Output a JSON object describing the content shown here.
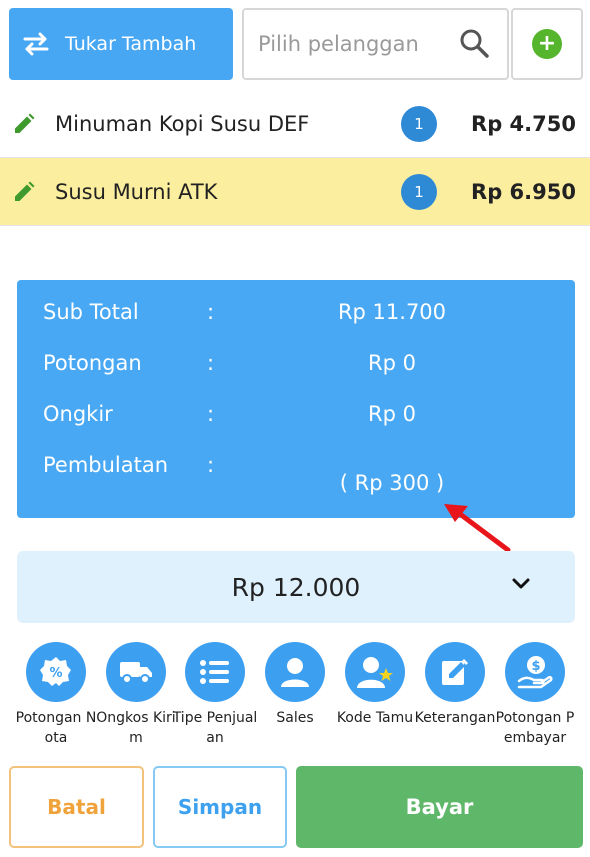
{
  "topbar": {
    "swap_label": "Tukar Tambah",
    "search_placeholder": "Pilih pelanggan"
  },
  "items": [
    {
      "name": "Minuman Kopi Susu DEF",
      "qty": "1",
      "price": "Rp 4.750",
      "highlighted": false
    },
    {
      "name": "Susu Murni ATK",
      "qty": "1",
      "price": "Rp 6.950",
      "highlighted": true
    }
  ],
  "summary": {
    "rows": [
      {
        "label": "Sub Total",
        "sep": ":",
        "value": "Rp 11.700"
      },
      {
        "label": "Potongan",
        "sep": ":",
        "value": "Rp 0"
      },
      {
        "label": "Ongkir",
        "sep": ":",
        "value": "Rp 0"
      },
      {
        "label": "Pembulatan",
        "sep": ":",
        "value": "( Rp 300 )"
      }
    ]
  },
  "total": {
    "amount": "Rp 12.000"
  },
  "options": [
    {
      "label": "Potongan Nota",
      "icon": "discount-badge-icon"
    },
    {
      "label": "Ongkos Kirim",
      "icon": "truck-icon"
    },
    {
      "label": "Tipe Penjualan",
      "icon": "list-icon"
    },
    {
      "label": "Sales",
      "icon": "person-icon"
    },
    {
      "label": "Kode Tamu",
      "icon": "guest-star-icon"
    },
    {
      "label": "Keterangan",
      "icon": "edit-note-icon"
    },
    {
      "label": "Potongan Pembayar",
      "icon": "money-hand-icon"
    }
  ],
  "actions": {
    "cancel_label": "Batal",
    "save_label": "Simpan",
    "pay_label": "Bayar"
  },
  "colors": {
    "primary_blue": "#48a7f3",
    "highlight_row": "#fbee9f",
    "pay_green": "#5fb76a",
    "cancel_orange": "#f0a33a",
    "add_green": "#55b52c",
    "annotation_arrow": "#e8161b"
  }
}
